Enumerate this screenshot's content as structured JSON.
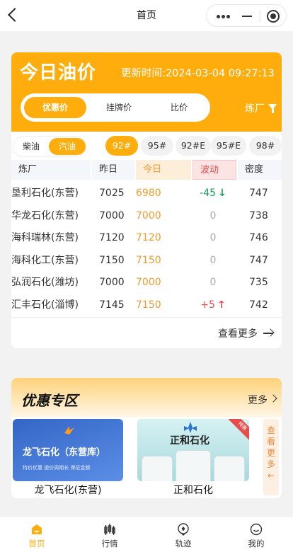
{
  "nav": {
    "title": "首页"
  },
  "price_card": {
    "title": "今日油价",
    "update_label": "更新时间:2024-03-04 09:27:13",
    "price_tabs": [
      "优惠价",
      "挂牌价",
      "比价"
    ],
    "refinery_filter": "炼厂",
    "fuel_types": [
      "柴油",
      "汽油"
    ],
    "grades": [
      "92#",
      "95#",
      "92#E",
      "95#E",
      "98#"
    ],
    "columns": [
      "炼厂",
      "昨日",
      "今日",
      "波动",
      "密度"
    ],
    "rows": [
      {
        "name": "垦利石化(东营)",
        "yesterday": "7025",
        "today": "6980",
        "change": "-45",
        "dir": "down",
        "density": "747"
      },
      {
        "name": "华龙石化(东营)",
        "yesterday": "7000",
        "today": "7000",
        "change": "0",
        "dir": "flat",
        "density": "738"
      },
      {
        "name": "海科瑞林(东营)",
        "yesterday": "7120",
        "today": "7120",
        "change": "0",
        "dir": "flat",
        "density": "746"
      },
      {
        "name": "海科化工(东营)",
        "yesterday": "7150",
        "today": "7150",
        "change": "0",
        "dir": "flat",
        "density": "747"
      },
      {
        "name": "弘润石化(潍坊)",
        "yesterday": "7000",
        "today": "7000",
        "change": "0",
        "dir": "flat",
        "density": "735"
      },
      {
        "name": "汇丰石化(淄博)",
        "yesterday": "7145",
        "today": "7150",
        "change": "+5",
        "dir": "up",
        "density": "742"
      }
    ],
    "more_label": "查看更多"
  },
  "promo": {
    "title": "优惠专区",
    "more_label": "更多",
    "items": [
      {
        "banner_text": "龙飞石化（东营库）",
        "banner_sub": "特价优惠  提价周期长  保证金额",
        "caption": "龙飞石化(东营)"
      },
      {
        "banner_text": "正和石化",
        "badge": "特惠",
        "caption": "正和石化"
      }
    ],
    "view_more_vertical": "查看更多←"
  },
  "tabbar": {
    "items": [
      "首页",
      "行情",
      "轨迹",
      "我的"
    ],
    "active": 0
  },
  "colors": {
    "accent": "#ffad0d",
    "up": "#e64c4c",
    "down": "#15a05a",
    "today": "#f19a2a"
  }
}
